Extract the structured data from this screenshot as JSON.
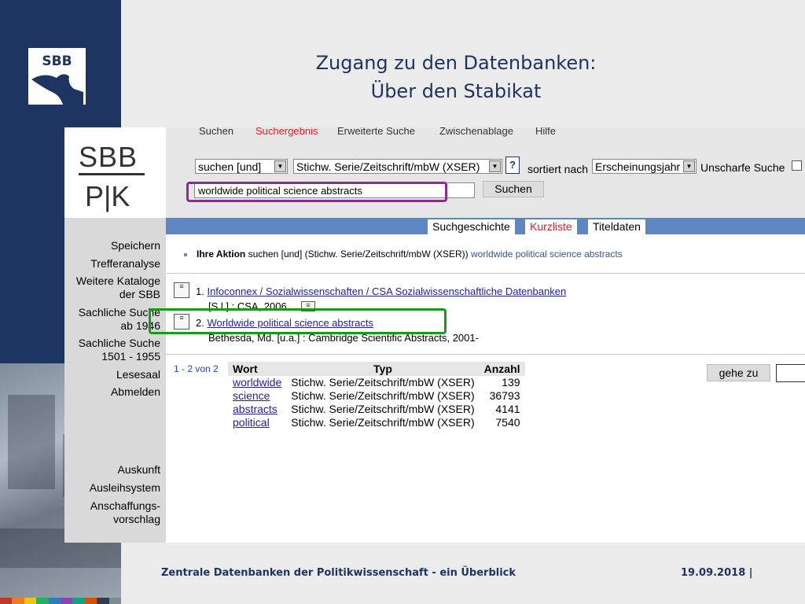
{
  "slide": {
    "title_line1": "Zugang zu den Datenbanken:",
    "title_line2": "Über den Stabikat",
    "logo_text": "SBB",
    "footer_text": "Zentrale Datenbanken der Politikwissenschaft - ein Überblick",
    "footer_date": "19.09.2018 |",
    "strip_colors": [
      "#c0392b",
      "#e67e22",
      "#f1c40f",
      "#27ae60",
      "#2980b9",
      "#8e44ad",
      "#16a085",
      "#d35400",
      "#2c3e50",
      "#7f8c8d"
    ]
  },
  "catalog": {
    "brand_line1": "SBB",
    "brand_line2": "P|K",
    "top_tabs": [
      "Suchen",
      "Suchergebnis",
      "Erweiterte Suche",
      "Zwischenablage",
      "Hilfe"
    ],
    "search": {
      "operator": "suchen [und]",
      "field": "Stichw. Serie/Zeitschrift/mbW (XSER)",
      "help": "?",
      "sort_label": "sortiert nach",
      "sort_value": "Erscheinungsjahr",
      "fuzzy_label": "Unscharfe Suche",
      "query": "worldwide political science abstracts",
      "submit": "Suchen"
    },
    "result_tabs": [
      "Suchgeschichte",
      "Kurzliste",
      "Titeldaten"
    ],
    "action": {
      "label": "Ihre Aktion",
      "text": "suchen [und] (Stichw. Serie/Zeitschrift/mbW (XSER))",
      "query": "worldwide political science abstracts"
    },
    "results": [
      {
        "num": "1.",
        "title": "Infoconnex / Sozialwissenschaften / CSA Sozialwissenschaftliche Datenbanken",
        "pub": "[S.l.] : CSA, 2006"
      },
      {
        "num": "2.",
        "title": "Worldwide political science abstracts",
        "pub": "Bethesda, Md. [u.a.] : Cambridge Scientific Abstracts, 2001-"
      }
    ],
    "pager": "1 - 2 von 2",
    "index_table": {
      "headers": [
        "Wort",
        "Typ",
        "Anzahl"
      ],
      "rows": [
        {
          "word": "worldwide",
          "type": "Stichw. Serie/Zeitschrift/mbW (XSER)",
          "count": "139"
        },
        {
          "word": "science",
          "type": "Stichw. Serie/Zeitschrift/mbW (XSER)",
          "count": "36793"
        },
        {
          "word": "abstracts",
          "type": "Stichw. Serie/Zeitschrift/mbW (XSER)",
          "count": "4141"
        },
        {
          "word": "political",
          "type": "Stichw. Serie/Zeitschrift/mbW (XSER)",
          "count": "7540"
        }
      ]
    },
    "goto_button": "gehe zu",
    "nav": {
      "speichern": "Speichern",
      "trefferanalyse": "Trefferanalyse",
      "weitere1": "Weitere Kataloge",
      "weitere2": "der SBB",
      "sach1946_1": "Sachliche Suche",
      "sach1946_2": "ab 1946",
      "sach1501_1": "Sachliche Suche",
      "sach1501_2": "1501 - 1955",
      "lesesaal": "Lesesaal",
      "abmelden": "Abmelden",
      "auskunft": "Auskunft",
      "ausleih": "Ausleihsystem",
      "anschaff1": "Anschaffungs-",
      "anschaff2": "vorschlag"
    }
  }
}
